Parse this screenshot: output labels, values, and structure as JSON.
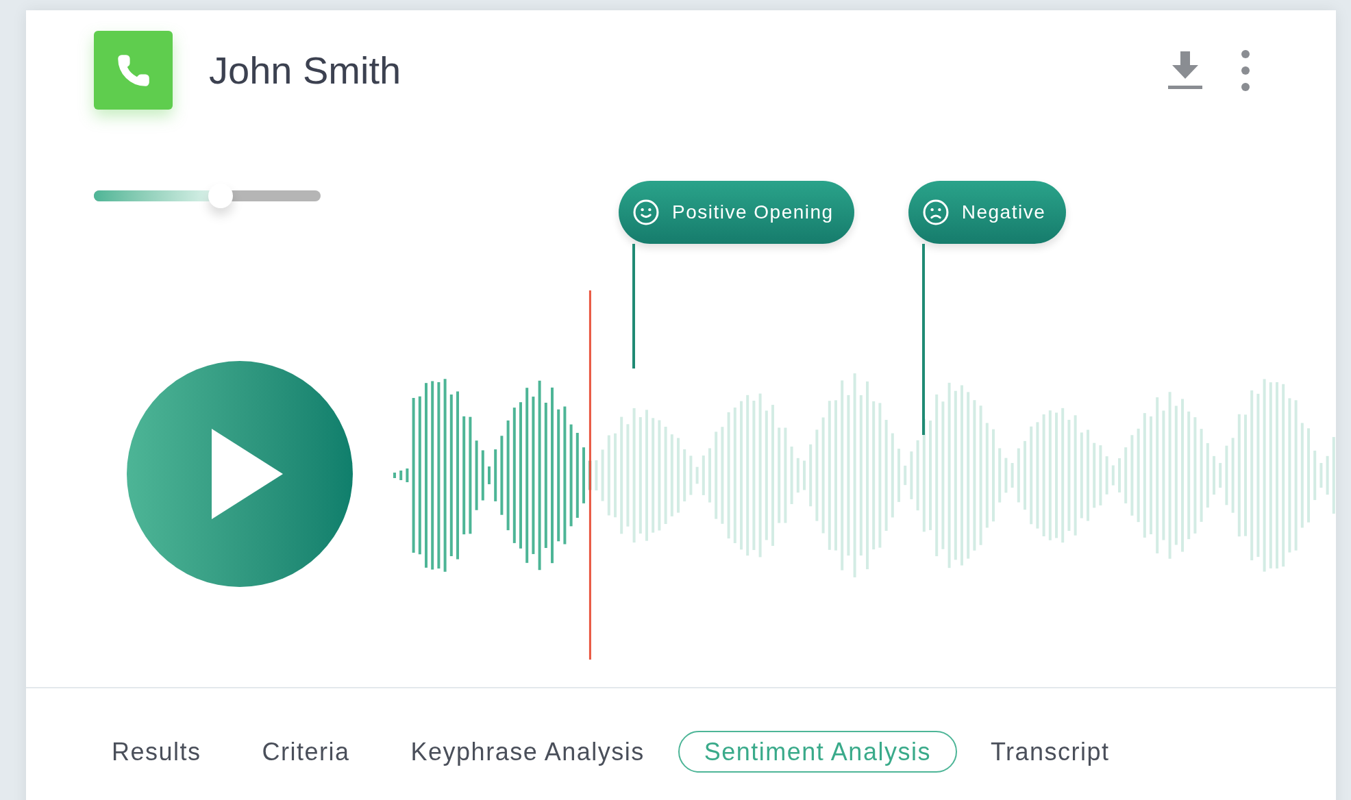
{
  "call": {
    "caller": "John Smith"
  },
  "slider": {
    "level": 0.56
  },
  "playback": {
    "level": 0.21
  },
  "markers": [
    {
      "label": "Positive Opening",
      "kind": "positive"
    },
    {
      "label": "Negative",
      "kind": "negative"
    }
  ],
  "tabs": [
    {
      "label": "Results",
      "selected": false
    },
    {
      "label": "Criteria",
      "selected": false
    },
    {
      "label": "Keyphrase Analysis",
      "selected": false
    },
    {
      "label": "Sentiment Analysis",
      "selected": true
    },
    {
      "label": "Transcript",
      "selected": false
    }
  ]
}
